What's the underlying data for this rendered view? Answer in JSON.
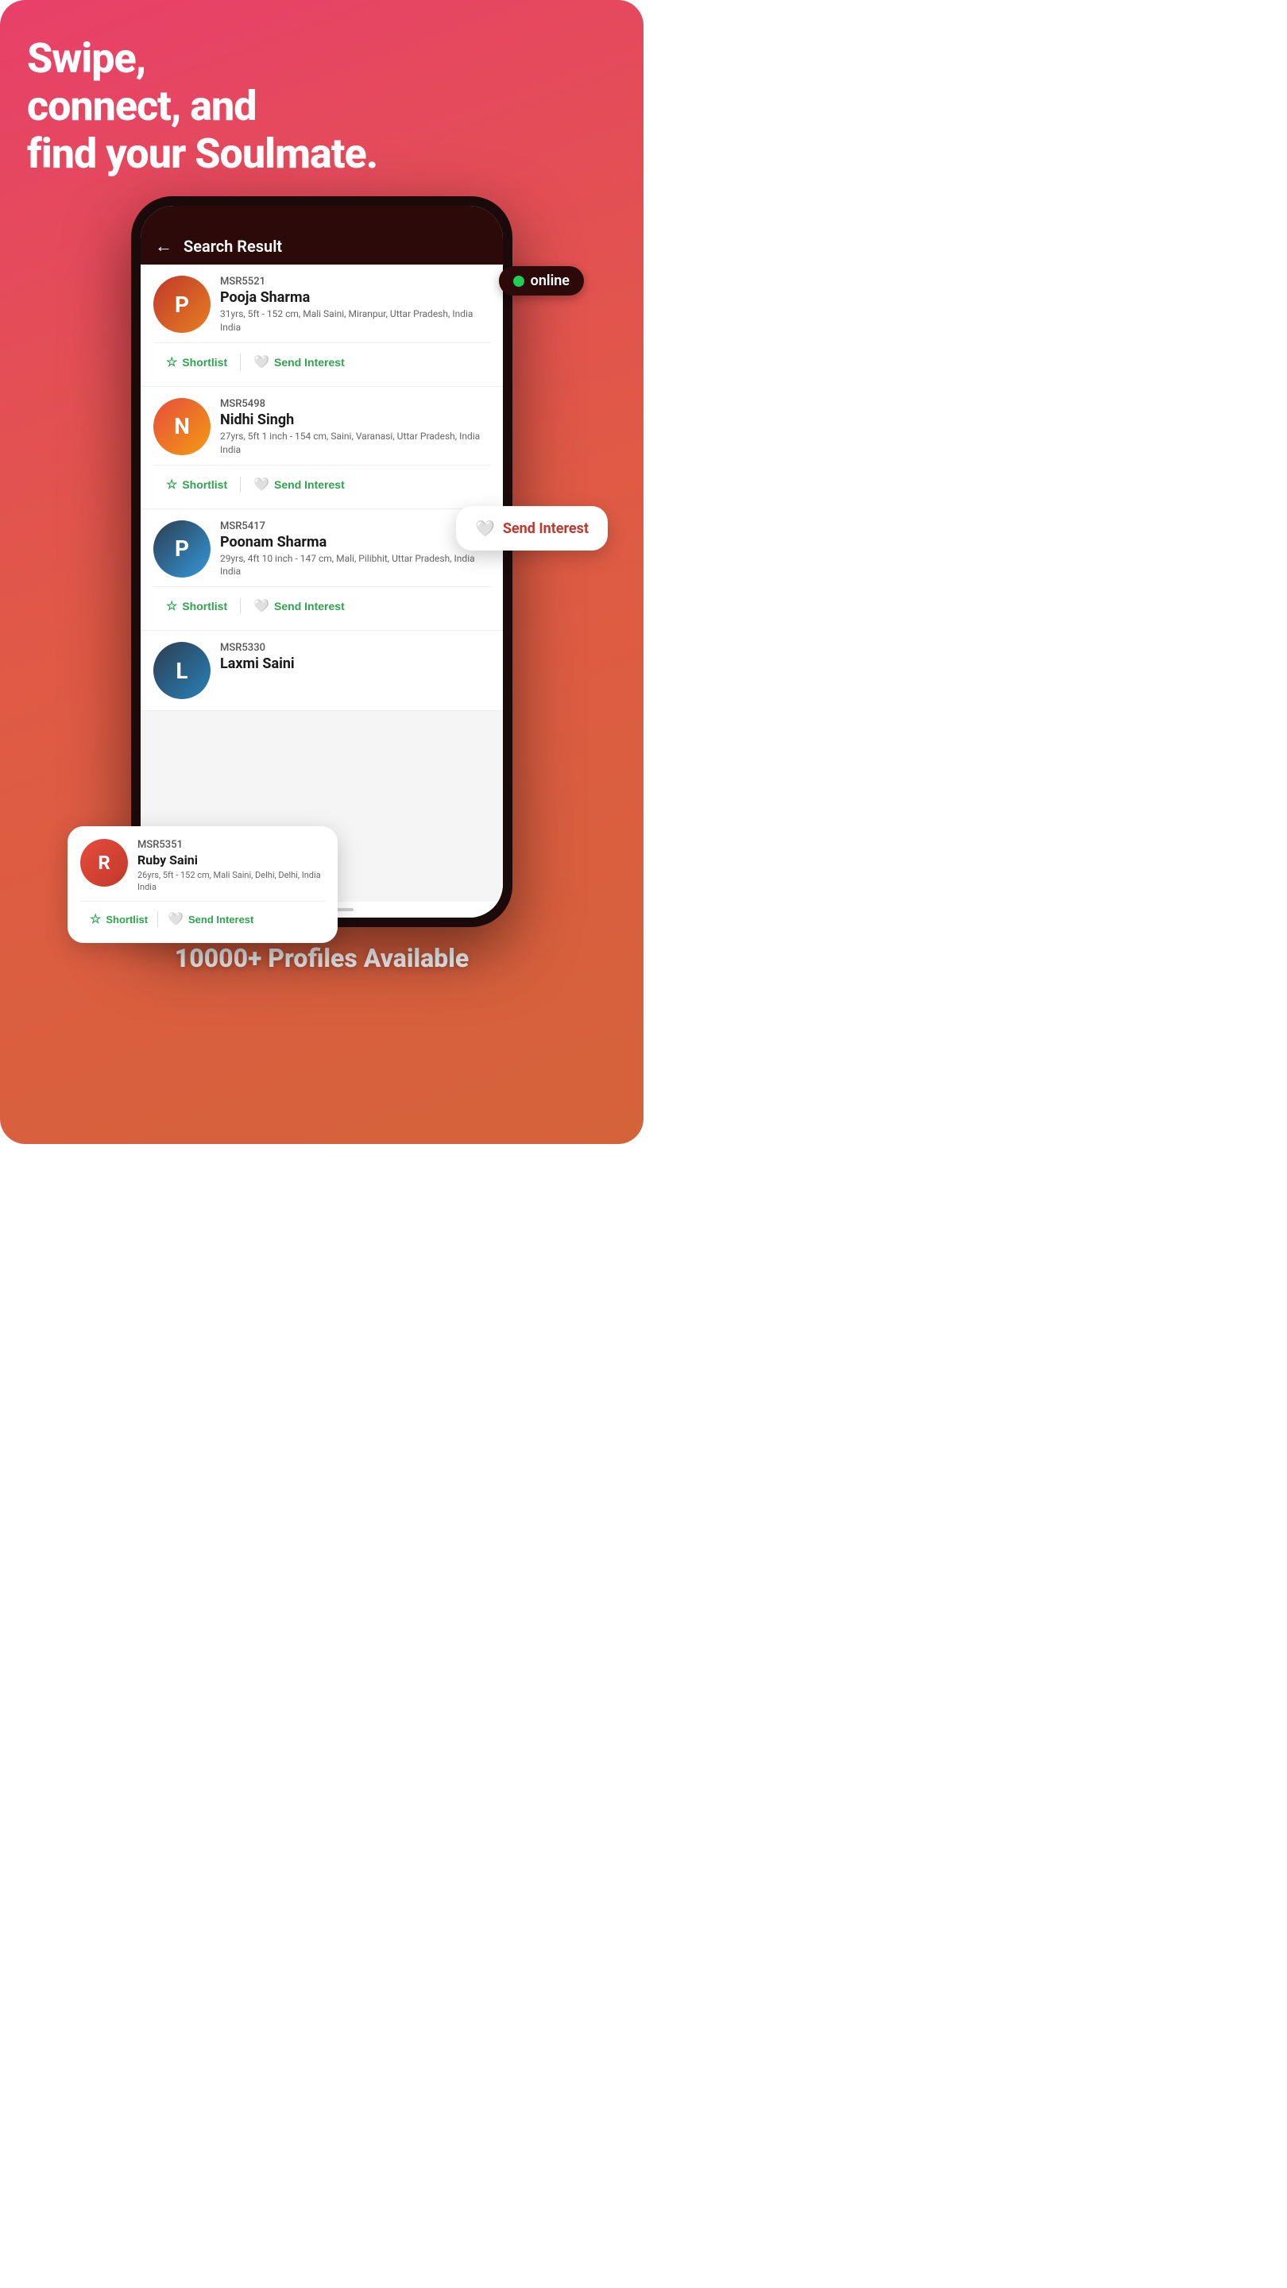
{
  "hero": {
    "tagline": "Swipe,\nconnect, and\nfind your Soulmate."
  },
  "header": {
    "title": "Search Result",
    "back_label": "←"
  },
  "online_badge": {
    "label": "online"
  },
  "profiles": [
    {
      "id": "MSR5521",
      "name": "Pooja Sharma",
      "details": "31yrs, 5ft - 152 cm, Mali Saini, Miranpur, Uttar Pradesh, India India",
      "avatar_color": "avatar-1",
      "avatar_letter": "P"
    },
    {
      "id": "MSR5498",
      "name": "Nidhi Singh",
      "details": "27yrs, 5ft 1 inch - 154 cm, Saini, Varanasi, Uttar Pradesh, India India",
      "avatar_color": "avatar-2",
      "avatar_letter": "N"
    },
    {
      "id": "MSR5417",
      "name": "Poonam Sharma",
      "details": "29yrs, 4ft 10 inch - 147 cm, Mali, Pilibhit, Uttar Pradesh, India India",
      "avatar_color": "avatar-3",
      "avatar_letter": "P"
    },
    {
      "id": "MSR5351",
      "name": "Ruby Saini",
      "details": "26yrs, 5ft - 152 cm, Mali Saini, Delhi, Delhi, India India",
      "avatar_color": "avatar-4",
      "avatar_letter": "R"
    },
    {
      "id": "MSR5330",
      "name": "Laxmi Saini",
      "details": "",
      "avatar_color": "avatar-5",
      "avatar_letter": "L"
    }
  ],
  "actions": {
    "shortlist": "Shortlist",
    "send_interest": "Send Interest"
  },
  "send_interest_popup": {
    "label": "Send Interest"
  },
  "floating_card": {
    "extra_details": "elhi, Delhi, India"
  },
  "footer": {
    "text": "10000+ Profiles Available"
  }
}
